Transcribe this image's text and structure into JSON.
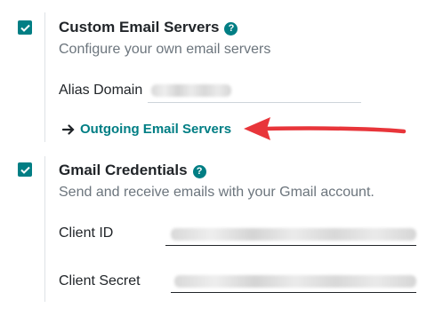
{
  "sections": [
    {
      "title": "Custom Email Servers",
      "checked": true,
      "description": "Configure your own email servers",
      "fields": [
        {
          "label": "Alias Domain",
          "value_obscured": true
        }
      ],
      "link_label": "Outgoing Email Servers"
    },
    {
      "title": "Gmail Credentials",
      "checked": true,
      "description": "Send and receive emails with your Gmail account.",
      "fields": [
        {
          "label": "Client ID",
          "value_obscured": true
        },
        {
          "label": "Client Secret",
          "value_obscured": true
        }
      ]
    }
  ],
  "icons": {
    "help": "question-circle-icon",
    "checkbox": "check-icon",
    "link": "arrow-right-icon",
    "annotation": "red-arrow-icon"
  },
  "colors": {
    "accent": "#017e84",
    "annotation_arrow": "#e8353a",
    "muted_text": "#6c757d"
  }
}
